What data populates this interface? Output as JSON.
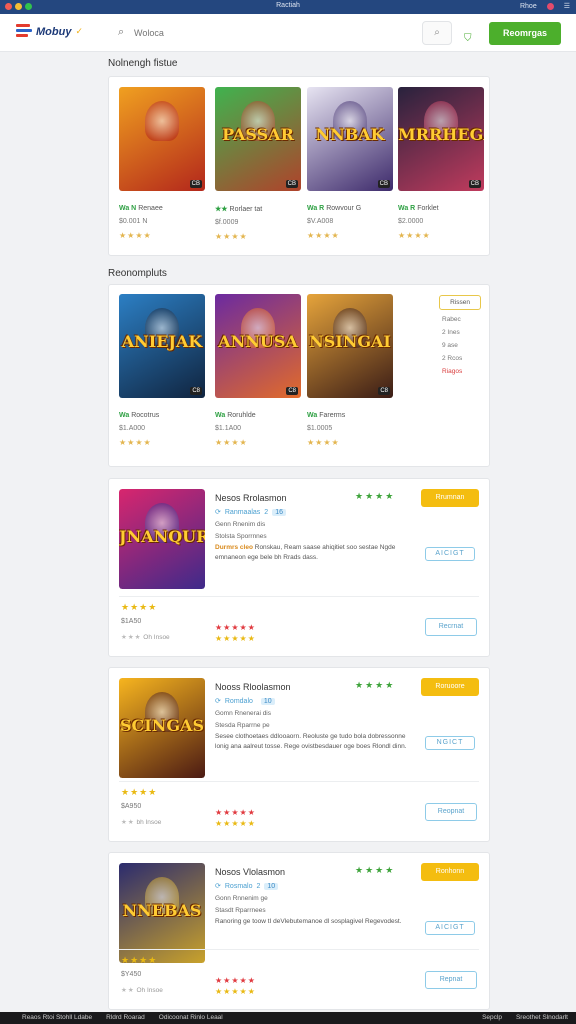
{
  "window": {
    "title": "Ractiah",
    "right_label": "Rhoe",
    "right_icon": "user-icon"
  },
  "header": {
    "logo_text": "Mobuy",
    "search_placeholder": "Woloca",
    "search_icon": "search-icon",
    "cart_icon": "bag-icon",
    "cta_label": "Reomrgas"
  },
  "sections": {
    "featured_title": "Nolnengh fistue",
    "recommended_title": "Reonompluts"
  },
  "featured": [
    {
      "caption": "",
      "badge": "CB",
      "tag": "Wa N",
      "name": "Renaee",
      "price": "$0.001 N",
      "stars": "★★★★",
      "colors": [
        "#f0a020",
        "#b3271b"
      ]
    },
    {
      "caption": "PASSAR",
      "badge": "CB",
      "tag": "★★",
      "name": "Rorlaer tat",
      "price": "$f.0009",
      "stars": "★★★★",
      "colors": [
        "#3fb34f",
        "#b0422b"
      ]
    },
    {
      "caption": "NNBAK",
      "badge": "CB",
      "tag": "Wa R",
      "name": "Rowvour G",
      "price": "$V.A008",
      "stars": "★★★★",
      "colors": [
        "#e7e4f2",
        "#3d2a6b"
      ]
    },
    {
      "caption": "MRRHEGA",
      "badge": "CB",
      "tag": "Wa R",
      "name": "Forklet",
      "price": "$2.0000",
      "stars": "★★★★",
      "colors": [
        "#28223d",
        "#c03b5d"
      ]
    }
  ],
  "recommended": [
    {
      "caption": "ANIEJAK",
      "badge": "C8",
      "tag": "Wa",
      "name": "Rocotrus",
      "price": "$1.A000",
      "stars": "★★★★",
      "colors": [
        "#2c7fc4",
        "#10243f"
      ]
    },
    {
      "caption": "ANNUSA",
      "badge": "C8",
      "tag": "Wa",
      "name": "Roruhlde",
      "price": "$1.1A00",
      "stars": "★★★★",
      "colors": [
        "#6b2aa0",
        "#e26b2a"
      ]
    },
    {
      "caption": "NSINGAI",
      "badge": "C8",
      "tag": "Wa",
      "name": "Farerms",
      "price": "$1.0005",
      "stars": "★★★★",
      "colors": [
        "#e6a43b",
        "#3a1c16"
      ]
    }
  ],
  "side_menu": {
    "header": "Rissen",
    "items": [
      "Rabec",
      "2 Ines",
      "9 ase",
      "2 Rcos"
    ],
    "hot_item": "Riagos"
  },
  "rows": [
    {
      "title": "Nesos Rrolasmon",
      "stars": "★★★★",
      "buy_label": "Rrumnan",
      "sub": "Ranmaalas",
      "sub_num": "2",
      "sub_tag": "16",
      "line1": "Genn Rnenim dis",
      "line2": "Stolsta Sporrnnes",
      "desc_lead": "Durmrs cleo",
      "desc": "Ronskau, Ream saase ahiqitiet soo sestae Ngde emnaneon ege bele bh Rrads dass.",
      "outline_label": "AICIGT",
      "price_stars": "★★★★",
      "price": "$1A50",
      "grey_stars": "★★★",
      "grey_text": "Oh Insoe",
      "rating_red": "★★★★★",
      "rating_yellow": "★★★★★",
      "action_label": "Recrnat",
      "colors": [
        "#d8266e",
        "#3e2a8a"
      ],
      "caption": "JNANQURI"
    },
    {
      "title": "Nooss Rloolasmon",
      "stars": "★★★★",
      "buy_label": "Roruoore",
      "sub": "Romdalo",
      "sub_num": "",
      "sub_tag": "10",
      "line1": "Gomn Rnenerai dis",
      "line2": "Stesda Rparrne pe",
      "desc_lead": "",
      "desc": "Sesee clothoetaes ddlooaorn. Reoluste ge tudo bola dobressonne lonig ana aalreut tosse. Rege ovistbesdauer oge boes Rlondl dinn.",
      "outline_label": "NGICT",
      "price_stars": "★★★★",
      "price": "$A950",
      "grey_stars": "★★",
      "grey_text": "bh Insoe",
      "rating_red": "★★★★★",
      "rating_yellow": "★★★★★",
      "action_label": "Reopnat",
      "colors": [
        "#f7b51f",
        "#4b1a13"
      ],
      "caption": "SCINGAS"
    },
    {
      "title": "Nosos Vlolasmon",
      "stars": "★★★★",
      "buy_label": "Ronhonn",
      "sub": "Rosmalo",
      "sub_num": "2",
      "sub_tag": "10",
      "line1": "Gonn Rnnenim ge",
      "line2": "Stasdt Rparrnees",
      "desc_lead": "",
      "desc": "Ranoring ge toow tI deVlebutemanoe dl sosplagivel Regevodest.",
      "outline_label": "AICIGT",
      "price_stars": "★★★★",
      "price": "$Y450",
      "grey_stars": "★★",
      "grey_text": "Oh Insoe",
      "rating_red": "★★★★★",
      "rating_yellow": "★★★★★",
      "action_label": "Repnat",
      "colors": [
        "#2b2b6e",
        "#c9a22b"
      ],
      "caption": "NNEBAS"
    }
  ],
  "taskbar": {
    "left": [
      "Reaos Rtoi Stohll Ldabe",
      "Rldrd Roarad",
      "Odicoonat Rinlo Leaal"
    ],
    "right": [
      "Sepclp",
      "Sreothet Slnodarlt"
    ]
  }
}
